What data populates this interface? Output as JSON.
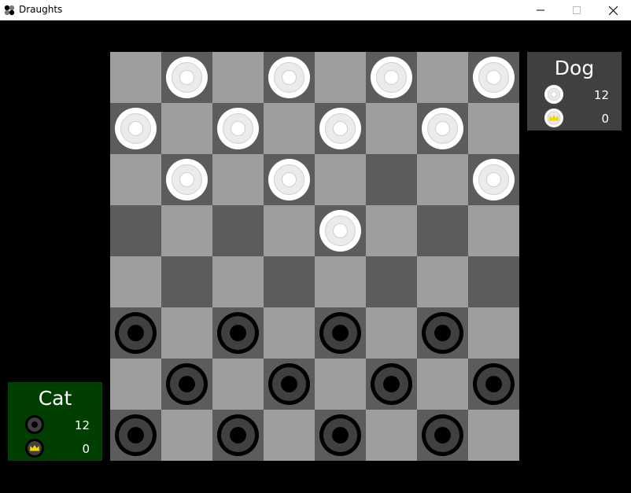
{
  "window": {
    "title": "Draughts",
    "controls": [
      "minimize-icon",
      "maximize-icon",
      "close-icon"
    ]
  },
  "colors": {
    "background": "#000000",
    "board_light": "#9e9e9e",
    "board_dark": "#5c5c5c",
    "white_piece": "#ffffff",
    "black_piece": "#000000",
    "dog_panel": "#404040",
    "cat_panel": "#003f00",
    "crown": "#f5d800"
  },
  "board": {
    "rows": [
      ".W.W.W.W",
      "W.W.W.W.",
      ".W.W...W",
      "....W...",
      "........",
      "B.B.B.B.",
      ".B.B.B.B",
      "B.B.B.B."
    ]
  },
  "players": {
    "dog": {
      "name": "Dog",
      "piece_color": "white",
      "pieces": "12",
      "kings": "0",
      "piece_icon": "white-piece-icon",
      "king_icon": "white-crown-icon"
    },
    "cat": {
      "name": "Cat",
      "piece_color": "black",
      "pieces": "12",
      "kings": "0",
      "piece_icon": "black-piece-icon",
      "king_icon": "black-crown-icon"
    }
  }
}
